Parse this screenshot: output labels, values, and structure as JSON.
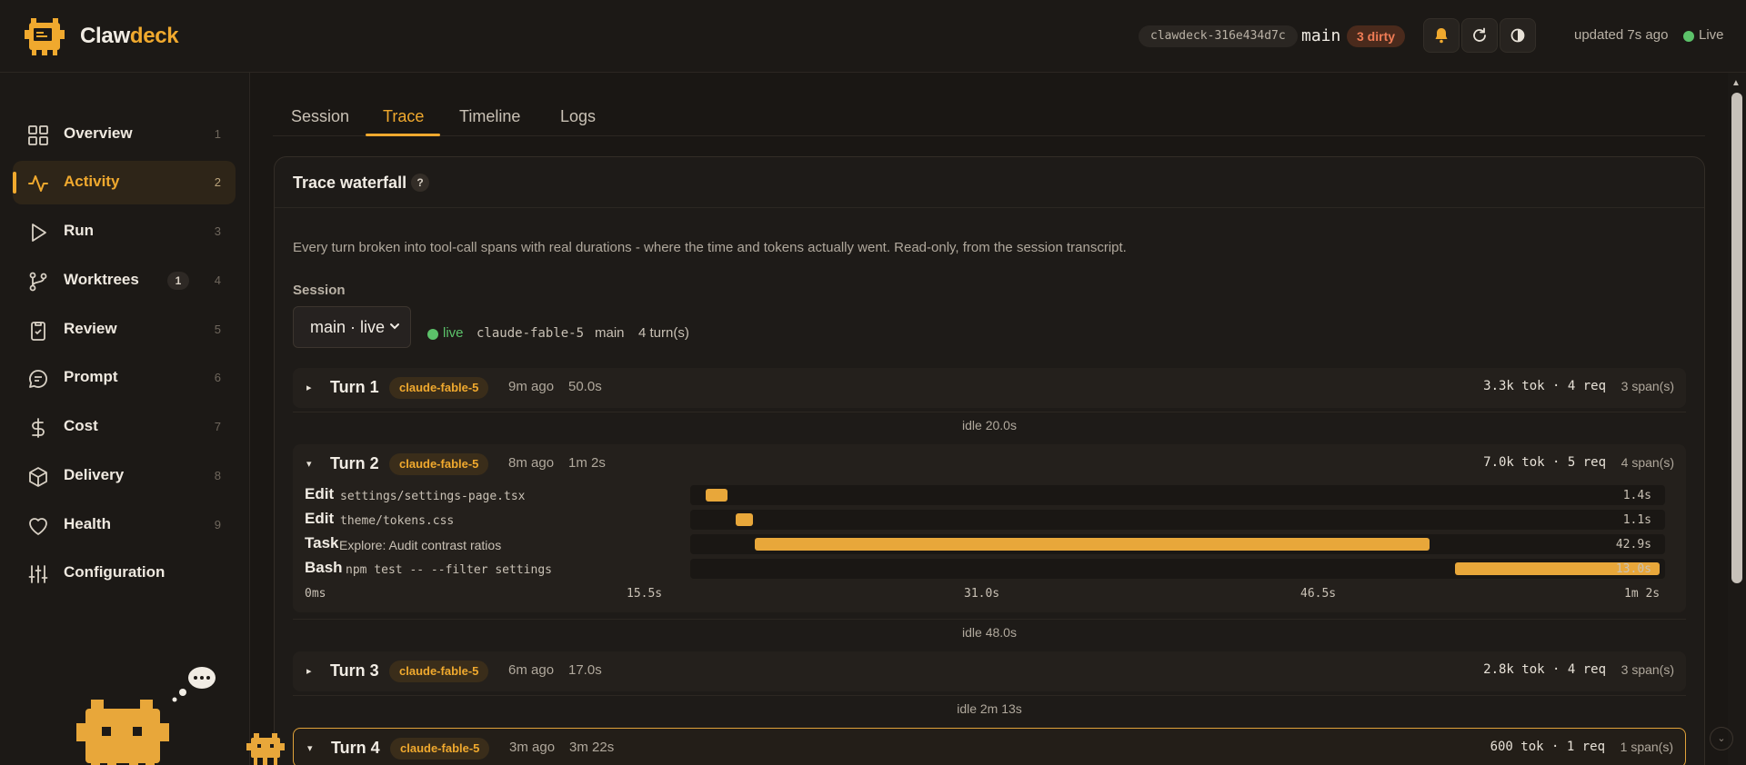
{
  "app": {
    "name_part1": "Claw",
    "name_part2": "deck",
    "brand_color": "#f0a92e"
  },
  "topbar": {
    "repo_chip": "clawdeck-316e434d7c",
    "branch": "main",
    "dirty_chip": "3 dirty",
    "updated": "updated 7s ago",
    "live": "Live",
    "icons": [
      "bell-icon",
      "refresh-icon",
      "contrast-icon"
    ]
  },
  "sidebar": {
    "items": [
      {
        "label": "Overview",
        "key": "1",
        "icon": "grid-icon"
      },
      {
        "label": "Activity",
        "key": "2",
        "icon": "pulse-icon",
        "active": true
      },
      {
        "label": "Run",
        "key": "3",
        "icon": "play-icon"
      },
      {
        "label": "Worktrees",
        "key": "4",
        "count": "1",
        "icon": "git-branch-icon"
      },
      {
        "label": "Review",
        "key": "5",
        "icon": "clipboard-check-icon"
      },
      {
        "label": "Prompt",
        "key": "6",
        "icon": "chat-bubble-icon"
      },
      {
        "label": "Cost",
        "key": "7",
        "icon": "dollar-icon"
      },
      {
        "label": "Delivery",
        "key": "8",
        "icon": "box-icon"
      },
      {
        "label": "Health",
        "key": "9",
        "icon": "heart-icon"
      },
      {
        "label": "Configuration",
        "key": "",
        "icon": "sliders-icon"
      }
    ]
  },
  "tabs": [
    {
      "label": "Session"
    },
    {
      "label": "Trace",
      "active": true
    },
    {
      "label": "Timeline"
    },
    {
      "label": "Logs"
    }
  ],
  "trace": {
    "title": "Trace waterfall",
    "help": "?",
    "description": "Every turn broken into tool-call spans with real durations - where the time and tokens actually went. Read-only, from the session transcript.",
    "session_label": "Session",
    "session_value": "main · live",
    "live": "live",
    "model": "claude-fable-5",
    "branch": "main",
    "turn_count": "4 turn(s)"
  },
  "turns": [
    {
      "title": "Turn 1",
      "model": "claude-fable-5",
      "ago": "9m ago",
      "duration": "50.0s",
      "stats": "3.3k tok · 4 req",
      "spans": "3 span(s)",
      "caret": "▸"
    },
    {
      "title": "Turn 2",
      "model": "claude-fable-5",
      "ago": "8m ago",
      "duration": "1m 2s",
      "stats": "7.0k tok · 5 req",
      "spans": "4 span(s)",
      "caret": "▾",
      "expanded": true
    },
    {
      "title": "Turn 3",
      "model": "claude-fable-5",
      "ago": "6m ago",
      "duration": "17.0s",
      "stats": "2.8k tok · 4 req",
      "spans": "3 span(s)",
      "caret": "▸"
    },
    {
      "title": "Turn 4",
      "model": "claude-fable-5",
      "ago": "3m ago",
      "duration": "3m 22s",
      "stats": "600 tok · 1 req",
      "spans": "1 span(s)",
      "caret": "▾",
      "selected": true
    }
  ],
  "idles": [
    "idle 20.0s",
    "idle 48.0s",
    "idle 2m 13s"
  ],
  "waterfall": {
    "total_seconds": 62,
    "spans": [
      {
        "tool": "Edit",
        "arg": "settings/settings-page.tsx",
        "arg_mono": true,
        "start_s": 1.0,
        "duration_s": 1.4,
        "label": "1.4s"
      },
      {
        "tool": "Edit",
        "arg": "theme/tokens.css",
        "arg_mono": true,
        "start_s": 2.9,
        "duration_s": 1.1,
        "label": "1.1s"
      },
      {
        "tool": "Task",
        "arg": "Explore: Audit contrast ratios",
        "arg_mono": false,
        "start_s": 4.1,
        "duration_s": 42.9,
        "label": "42.9s"
      },
      {
        "tool": "Bash",
        "arg": "npm test -- --filter settings",
        "arg_mono": true,
        "start_s": 49.0,
        "duration_s": 13.0,
        "label": "13.0s"
      }
    ],
    "axis": [
      "0ms",
      "15.5s",
      "31.0s",
      "46.5s",
      "1m 2s"
    ]
  }
}
